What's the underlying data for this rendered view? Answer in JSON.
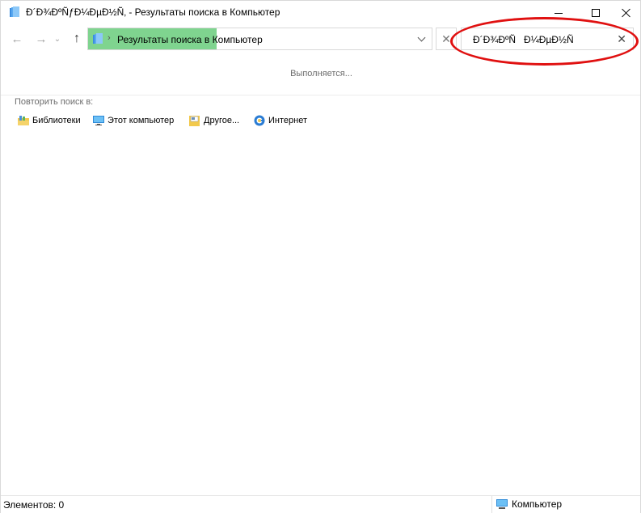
{
  "window": {
    "title": "Ð´Ð¾ÐºÑƒÐ¼ÐµÐ½Ñ‚ - Результаты поиска в Компьютер",
    "icon": "search-results-icon"
  },
  "nav": {
    "address_text": "Результаты поиска в Компьютер",
    "search_value": "Ð´Ð¾ÐºÑ   Ð¼ÐµÐ½Ñ",
    "search_progress": 0.375
  },
  "content": {
    "progress_message": "Выполняется...",
    "repeat_label": "Повторить поиск в:",
    "scopes": [
      {
        "label": "Библиотеки",
        "icon": "libraries-icon"
      },
      {
        "label": "Этот компьютер",
        "icon": "computer-icon"
      },
      {
        "label": "Другое...",
        "icon": "folder-other-icon"
      },
      {
        "label": "Интернет",
        "icon": "internet-icon"
      }
    ]
  },
  "status": {
    "item_count": "Элементов: 0",
    "location": "Компьютер"
  },
  "colors": {
    "progress": "#7fd48f",
    "annotation": "#e01010",
    "accent": "#0078d7"
  }
}
